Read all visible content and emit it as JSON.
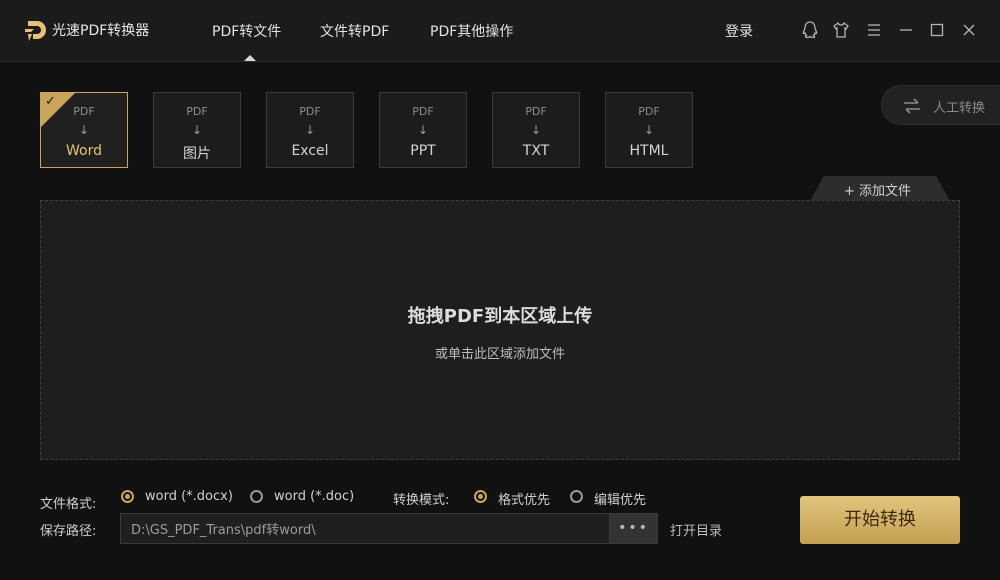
{
  "app": {
    "name": "光速PDF转换器"
  },
  "nav": {
    "tabs": [
      {
        "label": "PDF转文件"
      },
      {
        "label": "文件转PDF"
      },
      {
        "label": "PDF其他操作"
      }
    ],
    "login": "登录"
  },
  "window_controls": [
    "qq-icon",
    "skin-icon",
    "menu-icon",
    "minimize-icon",
    "maximize-icon",
    "close-icon"
  ],
  "formats": [
    {
      "top": "PDF",
      "label": "Word",
      "selected": true
    },
    {
      "top": "PDF",
      "label": "图片"
    },
    {
      "top": "PDF",
      "label": "Excel"
    },
    {
      "top": "PDF",
      "label": "PPT"
    },
    {
      "top": "PDF",
      "label": "TXT"
    },
    {
      "top": "PDF",
      "label": "HTML"
    }
  ],
  "manual_convert": {
    "label": "人工转换"
  },
  "add_file": {
    "label": "添加文件"
  },
  "dropzone": {
    "title": "拖拽PDF到本区域上传",
    "subtitle": "或单击此区域添加文件"
  },
  "options": {
    "format_label": "文件格式:",
    "format_options": [
      {
        "label": "word (*.docx)",
        "selected": true
      },
      {
        "label": "word (*.doc)",
        "selected": false
      }
    ],
    "mode_label": "转换模式:",
    "mode_options": [
      {
        "label": "格式优先",
        "selected": true
      },
      {
        "label": "编辑优先",
        "selected": false
      }
    ],
    "path_label": "保存路径:",
    "path_value": "D:\\GS_PDF_Trans\\pdf转word\\",
    "browse_label": "•••",
    "open_dir": "打开目录"
  },
  "start_button": "开始转换",
  "colors": {
    "accent_gold": "#c8a55a",
    "background": "#111111",
    "panel": "#1e1e1e"
  }
}
